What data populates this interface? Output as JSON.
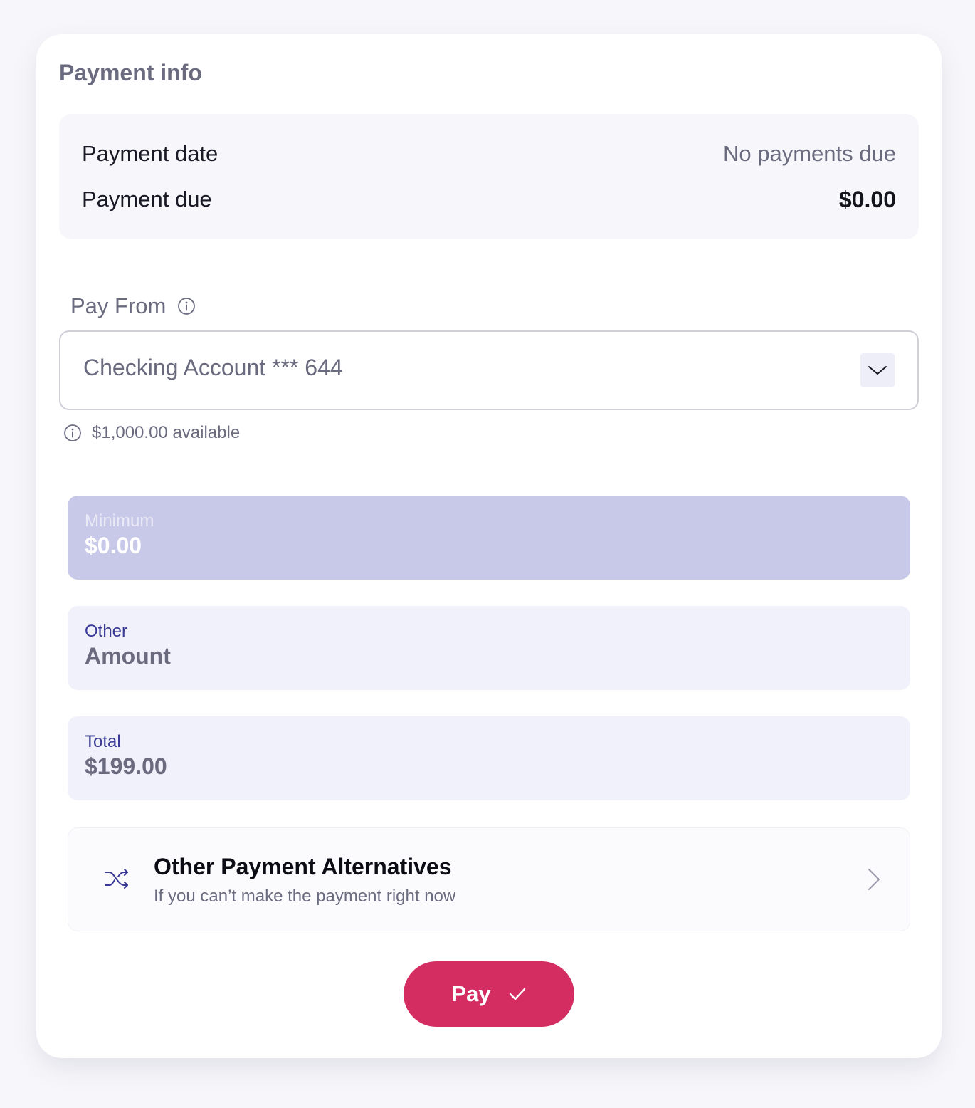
{
  "section_title": "Payment info",
  "summary": {
    "payment_date_label": "Payment date",
    "payment_date_value": "No payments due",
    "payment_due_label": "Payment due",
    "payment_due_value": "$0.00"
  },
  "pay_from": {
    "label": "Pay From",
    "selected_account": "Checking Account *** 644",
    "available_text": "$1,000.00 available"
  },
  "amount_options": {
    "minimum": {
      "label": "Minimum",
      "value": "$0.00"
    },
    "other": {
      "label": "Other",
      "value": "Amount"
    },
    "total": {
      "label": "Total",
      "value": "$199.00"
    }
  },
  "alternatives": {
    "title": "Other Payment Alternatives",
    "subtitle": "If you can’t make the payment right now"
  },
  "pay_button": {
    "label": "Pay"
  },
  "icons": {
    "info": "info-icon",
    "dropdown": "chevron-down-icon",
    "shuffle": "shuffle-icon",
    "arrow": "chevron-right-icon",
    "check": "check-icon"
  },
  "colors": {
    "accent": "#d42d62",
    "selected_option": "#c8c8e8",
    "option_background": "#f0f1fa",
    "option_label": "#3a3a96",
    "muted_text": "#6b6b80"
  }
}
